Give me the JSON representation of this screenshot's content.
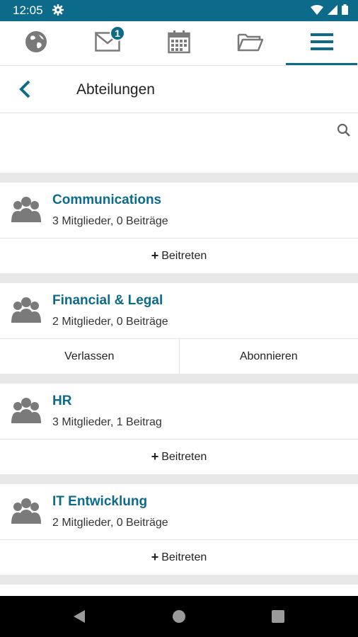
{
  "status": {
    "time": "12:05"
  },
  "tabs": [
    {
      "icon": "globe-icon"
    },
    {
      "icon": "mail-icon",
      "badge": "1"
    },
    {
      "icon": "calendar-icon"
    },
    {
      "icon": "folder-icon"
    },
    {
      "icon": "menu-icon",
      "active": true
    }
  ],
  "header": {
    "title": "Abteilungen"
  },
  "departments": [
    {
      "name": "Communications",
      "meta": "3 Mitglieder, 0 Beiträge",
      "actions": [
        "Beitreten"
      ]
    },
    {
      "name": "Financial & Legal",
      "meta": "2 Mitglieder, 0 Beiträge",
      "actions": [
        "Verlassen",
        "Abonnieren"
      ]
    },
    {
      "name": "HR",
      "meta": "3 Mitglieder, 1 Beitrag",
      "actions": [
        "Beitreten"
      ]
    },
    {
      "name": "IT Entwicklung",
      "meta": "2 Mitglieder, 0 Beiträge",
      "actions": [
        "Beitreten"
      ]
    }
  ],
  "colors": {
    "accent": "#0d6b8a",
    "icon_gray": "#7a7a7a"
  }
}
